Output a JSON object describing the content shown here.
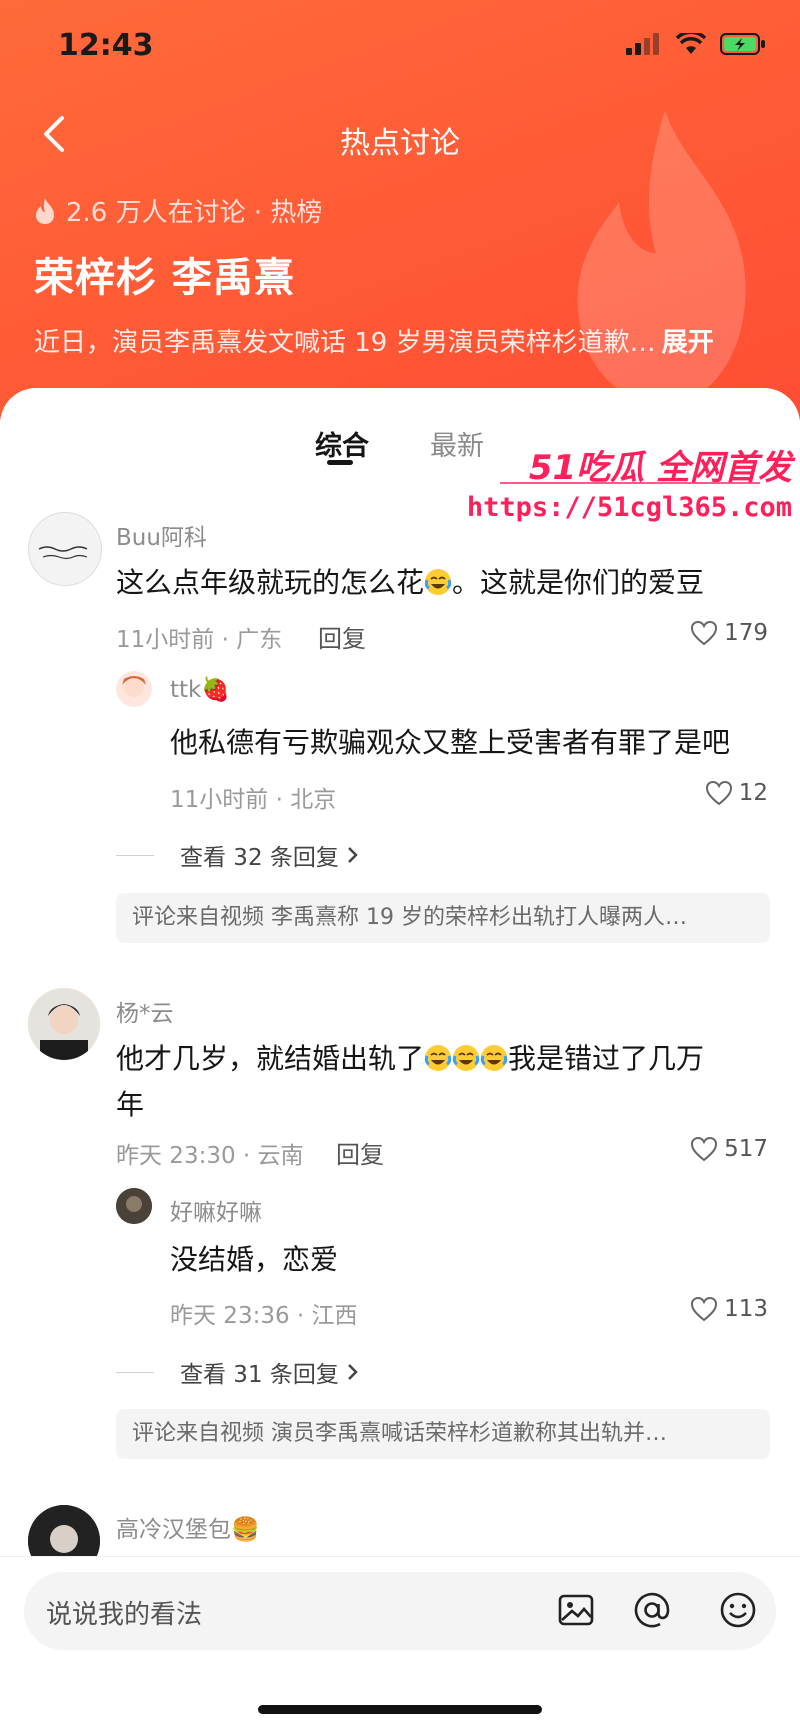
{
  "status": {
    "time": "12:43"
  },
  "header": {
    "title": "热点讨论",
    "meta": "2.6 万人在讨论 · 热榜",
    "topic": "荣梓杉 李禹熹",
    "summary": "近日，演员李禹熹发文喊话 19 岁男演员荣梓杉道歉…",
    "expand_label": "展开"
  },
  "tabs": {
    "active": "综合",
    "inactive": "最新"
  },
  "watermark": {
    "brand": "51吃瓜 全网首发",
    "url": "https://51cgl365.com"
  },
  "comments": [
    {
      "name": "Buu阿科",
      "text_before": "这么点年级就玩的怎么花",
      "text_after": "。这就是你们的爱豆",
      "time": "11小时前 · 广东",
      "reply": "回复",
      "likes": "179",
      "sub": {
        "name": "ttk🍓",
        "text": "他私德有亏欺骗观众又整上受害者有罪了是吧",
        "time": "11小时前 · 北京",
        "likes": "12"
      },
      "view_more": "查看 32 条回复",
      "source": "评论来自视频 李禹熹称 19 岁的荣梓杉出轨打人曝两人…"
    },
    {
      "name": "杨*云",
      "text_line1_before": "他才几岁，就结婚出轨了",
      "text_line1_after": "我是错过了几万",
      "text_line2": "年",
      "time": "昨天 23:30 · 云南",
      "reply": "回复",
      "likes": "517",
      "sub": {
        "name": "好嘛好嘛",
        "text": "没结婚，恋爱",
        "time": "昨天 23:36 · 江西",
        "likes": "113"
      },
      "view_more": "查看 31 条回复",
      "source": "评论来自视频 演员李禹熹喊话荣梓杉道歉称其出轨并…"
    },
    {
      "name": "高冷汉堡包🍔"
    }
  ],
  "input": {
    "placeholder": "说说我的看法"
  },
  "colors": {
    "header": "#ff5a36",
    "watermark": "#ff1f5a"
  }
}
